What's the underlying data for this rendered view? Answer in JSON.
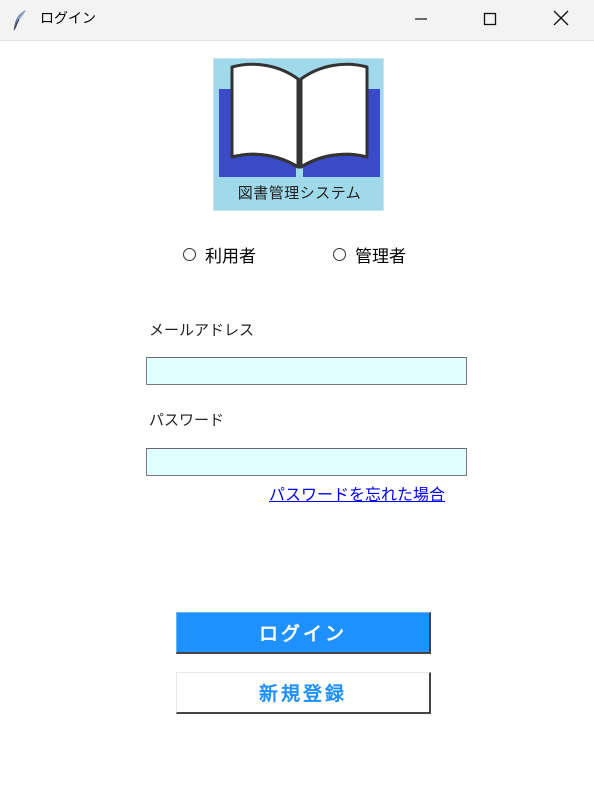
{
  "window": {
    "title": "ログイン",
    "icon": "feather-icon",
    "controls": {
      "minimize": "minimize-icon",
      "maximize": "maximize-icon",
      "close": "close-icon"
    }
  },
  "logo": {
    "icon": "open-book-icon",
    "text": "図書管理システム",
    "colors": {
      "background": "#9fd9ea",
      "cover": "#3b4bc8",
      "pages": "#ffffff"
    }
  },
  "role": {
    "options": [
      {
        "label": "利用者",
        "selected": false
      },
      {
        "label": "管理者",
        "selected": false
      }
    ]
  },
  "form": {
    "email_label": "メールアドレス",
    "email_value": "",
    "password_label": "パスワード",
    "password_value": "",
    "forgot_link": "パスワードを忘れた場合"
  },
  "buttons": {
    "login": "ログイン",
    "register": "新規登録"
  },
  "colors": {
    "accent": "#1e90ff",
    "input_background": "#e0ffff",
    "link": "#0000ee"
  }
}
